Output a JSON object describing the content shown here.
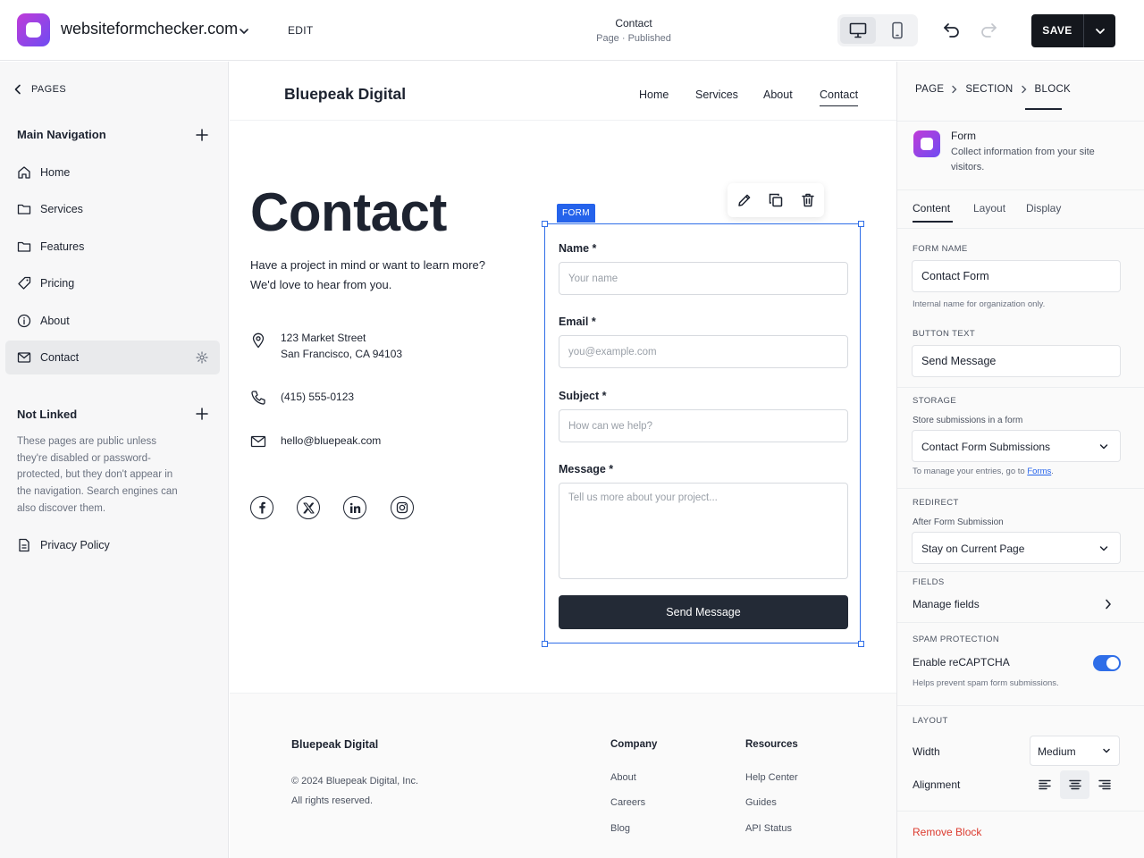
{
  "topbar": {
    "site_name": "websiteformchecker.com",
    "edit_label": "EDIT",
    "page_title": "Contact",
    "page_status": "Page · Published",
    "save_label": "SAVE",
    "device_modes": [
      "desktop-icon",
      "mobile-icon"
    ],
    "active_device": "desktop"
  },
  "left": {
    "back_label": "PAGES",
    "main_nav_heading": "Main Navigation",
    "main_nav": [
      {
        "label": "Home",
        "icon": "home-icon"
      },
      {
        "label": "Services",
        "icon": "folder-icon"
      },
      {
        "label": "Features",
        "icon": "folder-icon"
      },
      {
        "label": "Pricing",
        "icon": "tag-icon"
      },
      {
        "label": "About",
        "icon": "info-icon"
      },
      {
        "label": "Contact",
        "icon": "mail-icon",
        "active": true
      }
    ],
    "not_linked_heading": "Not Linked",
    "not_linked_desc": "These pages are public unless they're disabled or password-protected, but they don't appear in the navigation. Search engines can also discover them.",
    "not_linked_items": [
      {
        "label": "Privacy Policy",
        "icon": "document-icon"
      }
    ]
  },
  "site": {
    "brand": "Bluepeak Digital",
    "nav": [
      "Home",
      "Services",
      "About",
      "Contact"
    ],
    "current_nav": "Contact",
    "hero_title": "Contact",
    "hero_text": "Have a project in mind or want to learn more? We'd love to hear from you.",
    "address_line1": "123 Market Street",
    "address_line2": "San Francisco, CA 94103",
    "phone": "(415) 555-0123",
    "email": "hello@bluepeak.com",
    "socials": [
      "facebook-icon",
      "x-icon",
      "linkedin-icon",
      "instagram-icon"
    ]
  },
  "form": {
    "badge": "FORM",
    "fields": [
      {
        "label": "Name *",
        "placeholder": "Your name"
      },
      {
        "label": "Email *",
        "placeholder": "you@example.com"
      },
      {
        "label": "Subject *",
        "placeholder": "How can we help?"
      },
      {
        "label": "Message *",
        "placeholder": "Tell us more about your project..."
      }
    ],
    "submit_label": "Send Message",
    "toolbar": [
      "edit-icon",
      "duplicate-icon",
      "trash-icon"
    ]
  },
  "footer": {
    "brand": "Bluepeak Digital",
    "copyright": "© 2024 Bluepeak Digital, Inc.",
    "rights": "All rights reserved.",
    "company_heading": "Company",
    "company_links": [
      "About",
      "Careers",
      "Blog"
    ],
    "resources_heading": "Resources",
    "resources_links": [
      "Help Center",
      "Guides",
      "API Status"
    ]
  },
  "right": {
    "breadcrumb": [
      "PAGE",
      "SECTION",
      "BLOCK"
    ],
    "block_name": "Form",
    "block_desc": "Collect information from your site visitors.",
    "tabs": [
      "Content",
      "Layout",
      "Display"
    ],
    "active_tab": "Content",
    "form_name_caption": "FORM NAME",
    "form_name_value": "Contact Form",
    "form_name_help": "Internal name for organization only.",
    "button_text_caption": "BUTTON TEXT",
    "button_text_value": "Send Message",
    "storage_caption": "STORAGE",
    "storage_sub": "Store submissions in a form",
    "storage_value": "Contact Form Submissions",
    "storage_help_prefix": "To manage your entries, go to ",
    "storage_help_link": "Forms",
    "storage_help_suffix": ".",
    "redirect_caption": "REDIRECT",
    "redirect_sub": "After Form Submission",
    "redirect_value": "Stay on Current Page",
    "fields_caption": "FIELDS",
    "manage_fields_label": "Manage fields",
    "spam_caption": "SPAM PROTECTION",
    "recaptcha_label": "Enable reCAPTCHA",
    "recaptcha_enabled": true,
    "recaptcha_help": "Helps prevent spam form submissions.",
    "layout_caption": "LAYOUT",
    "width_label": "Width",
    "width_value": "Medium",
    "alignment_label": "Alignment",
    "alignment_value": "center",
    "remove_label": "Remove Block",
    "accent_color": "#2f6ee8",
    "danger_color": "#dc3b2f"
  }
}
